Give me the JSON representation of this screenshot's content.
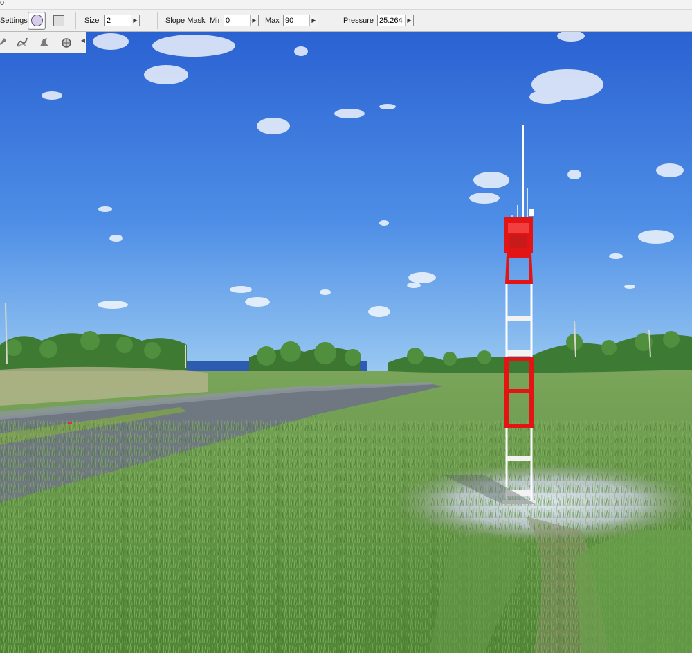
{
  "window": {
    "title_fragment": "o"
  },
  "toolbar": {
    "settings_label": "Settings",
    "shape_circle_icon": "circle-brush-icon",
    "shape_square_icon": "square-brush-icon",
    "size_label": "Size",
    "size_value": "2",
    "slope_mask_label": "Slope Mask",
    "min_label": "Min",
    "min_value": "0",
    "max_label": "Max",
    "max_value": "90",
    "pressure_label": "Pressure",
    "pressure_value": "25.264",
    "spin_arrow": "▶"
  },
  "tools": {
    "items": [
      {
        "icon": "sculpt-brush-icon"
      },
      {
        "icon": "smooth-brush-icon"
      },
      {
        "icon": "flatten-brush-icon"
      },
      {
        "icon": "noise-brush-icon"
      }
    ],
    "collapse_arrow": "◀"
  },
  "colors": {
    "sky_top": "#2a68d8",
    "sky_horizon": "#8fc2f0",
    "grass": "#5d8f3a",
    "road": "#6f7780",
    "tower_red": "#e21414",
    "tower_white": "#ffffff"
  }
}
